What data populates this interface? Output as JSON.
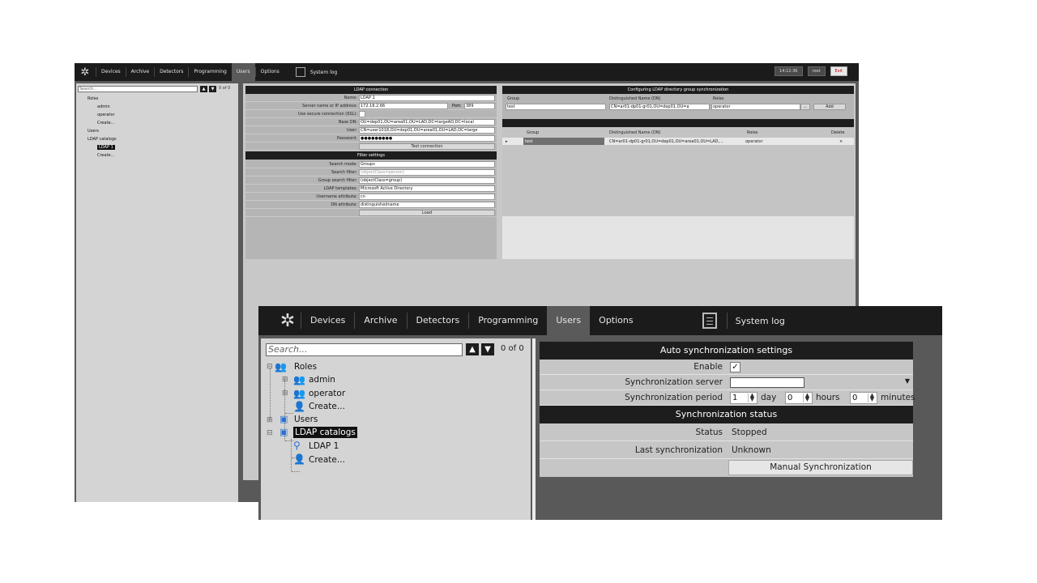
{
  "window_small": {
    "nav": [
      "Devices",
      "Archive",
      "Detectors",
      "Programming",
      "Users",
      "Options"
    ],
    "syslog": "System log",
    "clock": "14:12:36",
    "user": "root",
    "exit": "Exit",
    "search_placeholder": "Search...",
    "count": "0 of 0",
    "tree": [
      "Roles",
      "admin",
      "operator",
      "Create...",
      "Users",
      "LDAP catalogs",
      "LDAP 1",
      "Create..."
    ],
    "ldap": {
      "title": "LDAP connection",
      "name_label": "Name:",
      "name": "LDAP 1",
      "server_label": "Server name or IP address:",
      "server": "172.16.2.66",
      "port_label": "Port:",
      "port": "389",
      "ssl_label": "Use secure connection (SSL):",
      "basedn_label": "Base DN:",
      "basedn": "OU=dep01,OU=area01,OU=LAD,DC=largeAD,DC=local",
      "user_label": "User:",
      "user": "CN=user1018,OU=dep01,OU=area01,OU=LAD,DC=large",
      "password_label": "Password:",
      "password": "●●●●●●●●●",
      "test": "Test connection",
      "filter_title": "Filter settings",
      "mode_label": "Search mode:",
      "mode": "Groups",
      "filter_label": "Search filter:",
      "filter": "(objectClass=person)",
      "gfilter_label": "Group search filter:",
      "gfilter": "(objectClass=group)",
      "tmpl_label": "LDAP templates:",
      "tmpl": "Microsoft Active Directory",
      "uattr_label": "Username attribute:",
      "uattr": "cn",
      "dnattr_label": "DN attribute:",
      "dnattr": "distinguishedname",
      "load": "Load"
    },
    "sync": {
      "title": "Configuring LDAP directory group synchronization",
      "group_label": "Group",
      "dn_label": "Distinguished Name (DN)",
      "roles_label": "Roles",
      "group": "test",
      "dn": "CN=ar01-dp01-gr01,OU=dep01,OU=a",
      "role": "operator",
      "browse": "...",
      "add": "Add",
      "th_group": "Group",
      "th_dn": "Distinguished Name (DN)",
      "th_roles": "Roles",
      "th_delete": "Delete",
      "row_group": "test",
      "row_dn": "CN=ar01-dp01-gr01,OU=dep01,OU=area01,OU=LAD,...",
      "row_role": "operator",
      "row_del": "×"
    }
  },
  "window_large": {
    "nav": [
      "Devices",
      "Archive",
      "Detectors",
      "Programming",
      "Users",
      "Options"
    ],
    "syslog": "System log",
    "search_placeholder": "Search...",
    "count": "0 of 0",
    "tree": {
      "roles": "Roles",
      "admin": "admin",
      "operator": "operator",
      "create_role": "Create...",
      "users": "Users",
      "ldap_catalogs": "LDAP catalogs",
      "ldap1": "LDAP 1",
      "create_ldap": "Create..."
    },
    "auto_sync": {
      "title": "Auto synchronization settings",
      "enable_label": "Enable",
      "enable_check": "✓",
      "server_label": "Synchronization server",
      "period_label": "Synchronization period",
      "day_value": "1",
      "day_unit": "day",
      "hours_value": "0",
      "hours_unit": "hours",
      "minutes_value": "0",
      "minutes_unit": "minutes"
    },
    "status": {
      "title": "Synchronization status",
      "status_label": "Status",
      "status_value": "Stopped",
      "last_label": "Last synchronization",
      "last_value": "Unknown",
      "manual_button": "Manual Synchronization"
    }
  }
}
